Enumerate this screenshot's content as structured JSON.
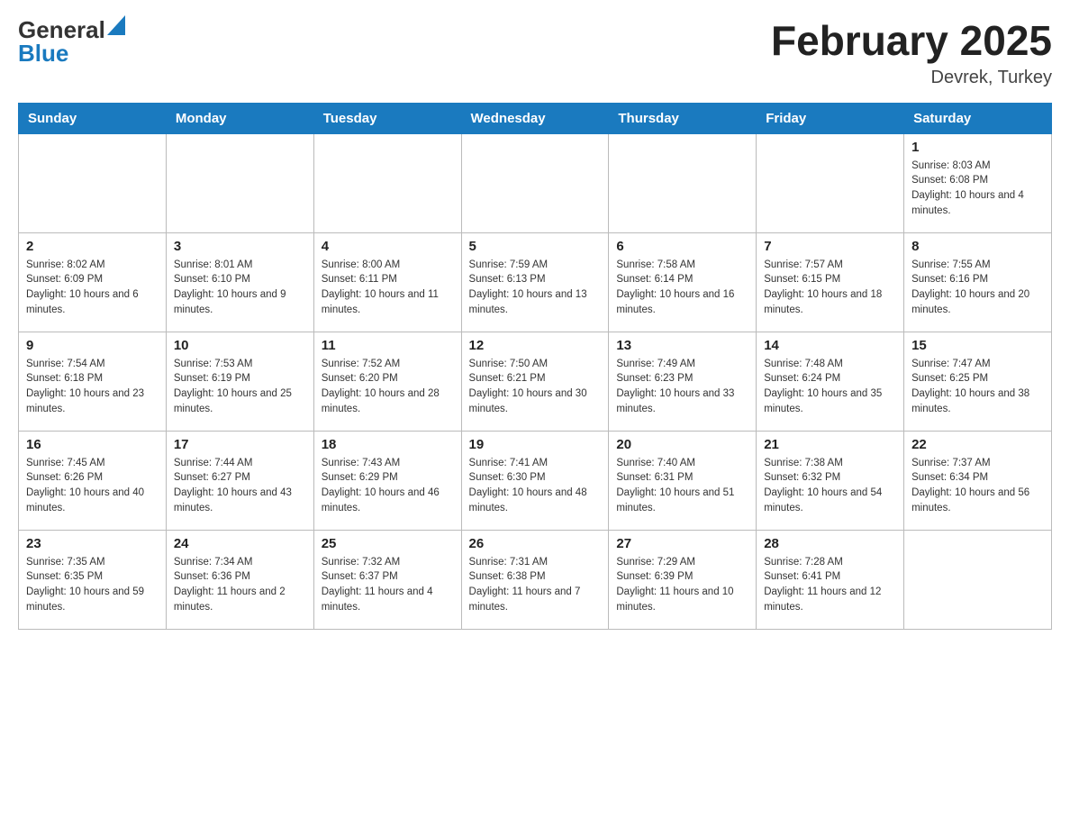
{
  "header": {
    "logo_general": "General",
    "logo_blue": "Blue",
    "month_title": "February 2025",
    "location": "Devrek, Turkey"
  },
  "days_of_week": [
    "Sunday",
    "Monday",
    "Tuesday",
    "Wednesday",
    "Thursday",
    "Friday",
    "Saturday"
  ],
  "weeks": [
    {
      "days": [
        {
          "num": "",
          "info": ""
        },
        {
          "num": "",
          "info": ""
        },
        {
          "num": "",
          "info": ""
        },
        {
          "num": "",
          "info": ""
        },
        {
          "num": "",
          "info": ""
        },
        {
          "num": "",
          "info": ""
        },
        {
          "num": "1",
          "info": "Sunrise: 8:03 AM\nSunset: 6:08 PM\nDaylight: 10 hours and 4 minutes."
        }
      ]
    },
    {
      "days": [
        {
          "num": "2",
          "info": "Sunrise: 8:02 AM\nSunset: 6:09 PM\nDaylight: 10 hours and 6 minutes."
        },
        {
          "num": "3",
          "info": "Sunrise: 8:01 AM\nSunset: 6:10 PM\nDaylight: 10 hours and 9 minutes."
        },
        {
          "num": "4",
          "info": "Sunrise: 8:00 AM\nSunset: 6:11 PM\nDaylight: 10 hours and 11 minutes."
        },
        {
          "num": "5",
          "info": "Sunrise: 7:59 AM\nSunset: 6:13 PM\nDaylight: 10 hours and 13 minutes."
        },
        {
          "num": "6",
          "info": "Sunrise: 7:58 AM\nSunset: 6:14 PM\nDaylight: 10 hours and 16 minutes."
        },
        {
          "num": "7",
          "info": "Sunrise: 7:57 AM\nSunset: 6:15 PM\nDaylight: 10 hours and 18 minutes."
        },
        {
          "num": "8",
          "info": "Sunrise: 7:55 AM\nSunset: 6:16 PM\nDaylight: 10 hours and 20 minutes."
        }
      ]
    },
    {
      "days": [
        {
          "num": "9",
          "info": "Sunrise: 7:54 AM\nSunset: 6:18 PM\nDaylight: 10 hours and 23 minutes."
        },
        {
          "num": "10",
          "info": "Sunrise: 7:53 AM\nSunset: 6:19 PM\nDaylight: 10 hours and 25 minutes."
        },
        {
          "num": "11",
          "info": "Sunrise: 7:52 AM\nSunset: 6:20 PM\nDaylight: 10 hours and 28 minutes."
        },
        {
          "num": "12",
          "info": "Sunrise: 7:50 AM\nSunset: 6:21 PM\nDaylight: 10 hours and 30 minutes."
        },
        {
          "num": "13",
          "info": "Sunrise: 7:49 AM\nSunset: 6:23 PM\nDaylight: 10 hours and 33 minutes."
        },
        {
          "num": "14",
          "info": "Sunrise: 7:48 AM\nSunset: 6:24 PM\nDaylight: 10 hours and 35 minutes."
        },
        {
          "num": "15",
          "info": "Sunrise: 7:47 AM\nSunset: 6:25 PM\nDaylight: 10 hours and 38 minutes."
        }
      ]
    },
    {
      "days": [
        {
          "num": "16",
          "info": "Sunrise: 7:45 AM\nSunset: 6:26 PM\nDaylight: 10 hours and 40 minutes."
        },
        {
          "num": "17",
          "info": "Sunrise: 7:44 AM\nSunset: 6:27 PM\nDaylight: 10 hours and 43 minutes."
        },
        {
          "num": "18",
          "info": "Sunrise: 7:43 AM\nSunset: 6:29 PM\nDaylight: 10 hours and 46 minutes."
        },
        {
          "num": "19",
          "info": "Sunrise: 7:41 AM\nSunset: 6:30 PM\nDaylight: 10 hours and 48 minutes."
        },
        {
          "num": "20",
          "info": "Sunrise: 7:40 AM\nSunset: 6:31 PM\nDaylight: 10 hours and 51 minutes."
        },
        {
          "num": "21",
          "info": "Sunrise: 7:38 AM\nSunset: 6:32 PM\nDaylight: 10 hours and 54 minutes."
        },
        {
          "num": "22",
          "info": "Sunrise: 7:37 AM\nSunset: 6:34 PM\nDaylight: 10 hours and 56 minutes."
        }
      ]
    },
    {
      "days": [
        {
          "num": "23",
          "info": "Sunrise: 7:35 AM\nSunset: 6:35 PM\nDaylight: 10 hours and 59 minutes."
        },
        {
          "num": "24",
          "info": "Sunrise: 7:34 AM\nSunset: 6:36 PM\nDaylight: 11 hours and 2 minutes."
        },
        {
          "num": "25",
          "info": "Sunrise: 7:32 AM\nSunset: 6:37 PM\nDaylight: 11 hours and 4 minutes."
        },
        {
          "num": "26",
          "info": "Sunrise: 7:31 AM\nSunset: 6:38 PM\nDaylight: 11 hours and 7 minutes."
        },
        {
          "num": "27",
          "info": "Sunrise: 7:29 AM\nSunset: 6:39 PM\nDaylight: 11 hours and 10 minutes."
        },
        {
          "num": "28",
          "info": "Sunrise: 7:28 AM\nSunset: 6:41 PM\nDaylight: 11 hours and 12 minutes."
        },
        {
          "num": "",
          "info": ""
        }
      ]
    }
  ]
}
